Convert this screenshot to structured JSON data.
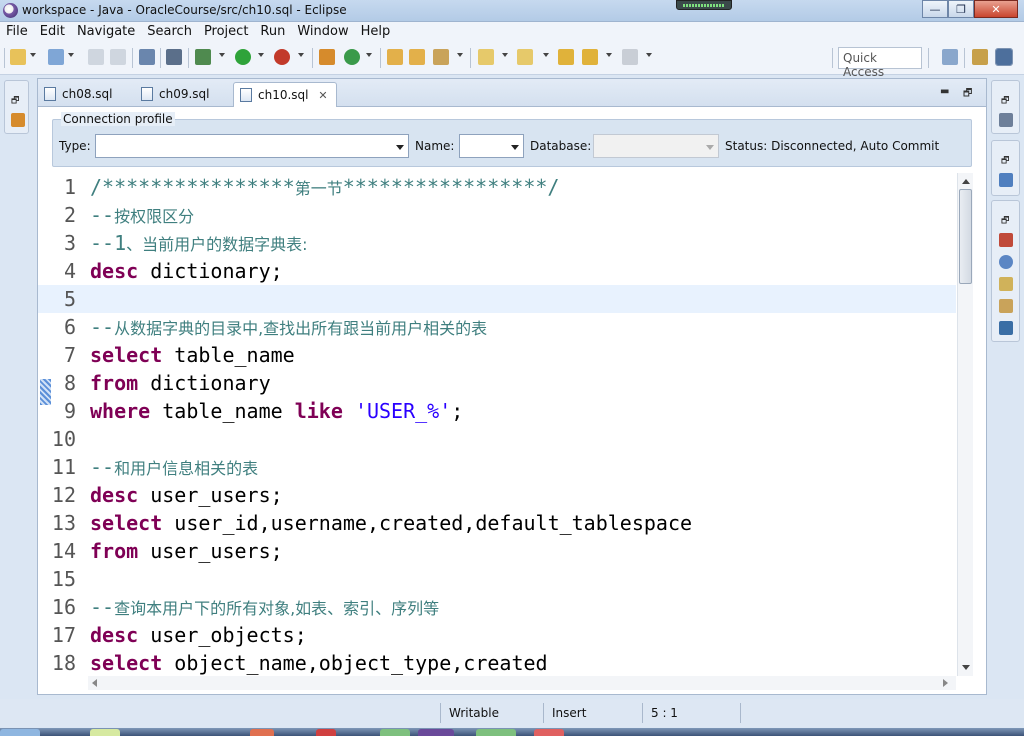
{
  "window": {
    "title": "workspace - Java - OracleCourse/src/ch10.sql - Eclipse",
    "minimize": "—",
    "restore": "❐",
    "close": "✕"
  },
  "menu": [
    "File",
    "Edit",
    "Navigate",
    "Search",
    "Project",
    "Run",
    "Window",
    "Help"
  ],
  "quick_access": {
    "placeholder": "Quick Access"
  },
  "tabs": [
    {
      "label": "ch08.sql",
      "active": false
    },
    {
      "label": "ch09.sql",
      "active": false
    },
    {
      "label": "ch10.sql",
      "active": true
    }
  ],
  "connection_profile": {
    "legend": "Connection profile",
    "type_label": "Type:",
    "type_value": "",
    "name_label": "Name:",
    "name_value": "",
    "database_label": "Database:",
    "database_value": "",
    "status": "Status: Disconnected, Auto Commit"
  },
  "code_lines": [
    {
      "n": "1",
      "segs": [
        {
          "t": "/****************",
          "c": "cmt"
        },
        {
          "t": "第一节",
          "c": "cmt-cjk"
        },
        {
          "t": "*****************/",
          "c": "cmt"
        }
      ]
    },
    {
      "n": "2",
      "segs": [
        {
          "t": "--",
          "c": "cmt"
        },
        {
          "t": "按权限区分",
          "c": "cmt-cjk"
        }
      ]
    },
    {
      "n": "3",
      "segs": [
        {
          "t": "--1",
          "c": "cmt"
        },
        {
          "t": "、当前用户的数据字典表:",
          "c": "cmt-cjk"
        }
      ]
    },
    {
      "n": "4",
      "segs": [
        {
          "t": "desc",
          "c": "kw"
        },
        {
          "t": " dictionary;",
          "c": ""
        }
      ]
    },
    {
      "n": "5",
      "segs": [],
      "current": true
    },
    {
      "n": "6",
      "segs": [
        {
          "t": "--",
          "c": "cmt"
        },
        {
          "t": "从数据字典的目录中,查找出所有跟当前用户相关的表",
          "c": "cmt-cjk"
        }
      ]
    },
    {
      "n": "7",
      "segs": [
        {
          "t": "select",
          "c": "kw"
        },
        {
          "t": " table_name",
          "c": ""
        }
      ]
    },
    {
      "n": "8",
      "segs": [
        {
          "t": "from",
          "c": "kw"
        },
        {
          "t": " dictionary",
          "c": ""
        }
      ]
    },
    {
      "n": "9",
      "segs": [
        {
          "t": "where",
          "c": "kw"
        },
        {
          "t": " table_name ",
          "c": ""
        },
        {
          "t": "like",
          "c": "kw"
        },
        {
          "t": " ",
          "c": ""
        },
        {
          "t": "'USER_%'",
          "c": "str"
        },
        {
          "t": ";",
          "c": ""
        }
      ]
    },
    {
      "n": "10",
      "segs": []
    },
    {
      "n": "11",
      "segs": [
        {
          "t": "--",
          "c": "cmt"
        },
        {
          "t": "和用户信息相关的表",
          "c": "cmt-cjk"
        }
      ]
    },
    {
      "n": "12",
      "segs": [
        {
          "t": "desc",
          "c": "kw"
        },
        {
          "t": " user_users;",
          "c": ""
        }
      ]
    },
    {
      "n": "13",
      "segs": [
        {
          "t": "select",
          "c": "kw"
        },
        {
          "t": " user_id,username,created,default_tablespace",
          "c": ""
        }
      ]
    },
    {
      "n": "14",
      "segs": [
        {
          "t": "from",
          "c": "kw"
        },
        {
          "t": " user_users;",
          "c": ""
        }
      ]
    },
    {
      "n": "15",
      "segs": []
    },
    {
      "n": "16",
      "segs": [
        {
          "t": "--",
          "c": "cmt"
        },
        {
          "t": "查询本用户下的所有对象,如表、索引、序列等",
          "c": "cmt-cjk"
        }
      ]
    },
    {
      "n": "17",
      "segs": [
        {
          "t": "desc",
          "c": "kw"
        },
        {
          "t": " user_objects;",
          "c": ""
        }
      ]
    },
    {
      "n": "18",
      "segs": [
        {
          "t": "select",
          "c": "kw"
        },
        {
          "t": " object_name,object_type,created",
          "c": ""
        }
      ]
    }
  ],
  "statusbar": {
    "mode": "Writable",
    "insert": "Insert",
    "position": "5 : 1"
  },
  "colors": {
    "keyword": "#7f0055",
    "comment": "#3f7f7f",
    "string": "#2a00ff",
    "current_line": "#e8f2fe"
  }
}
